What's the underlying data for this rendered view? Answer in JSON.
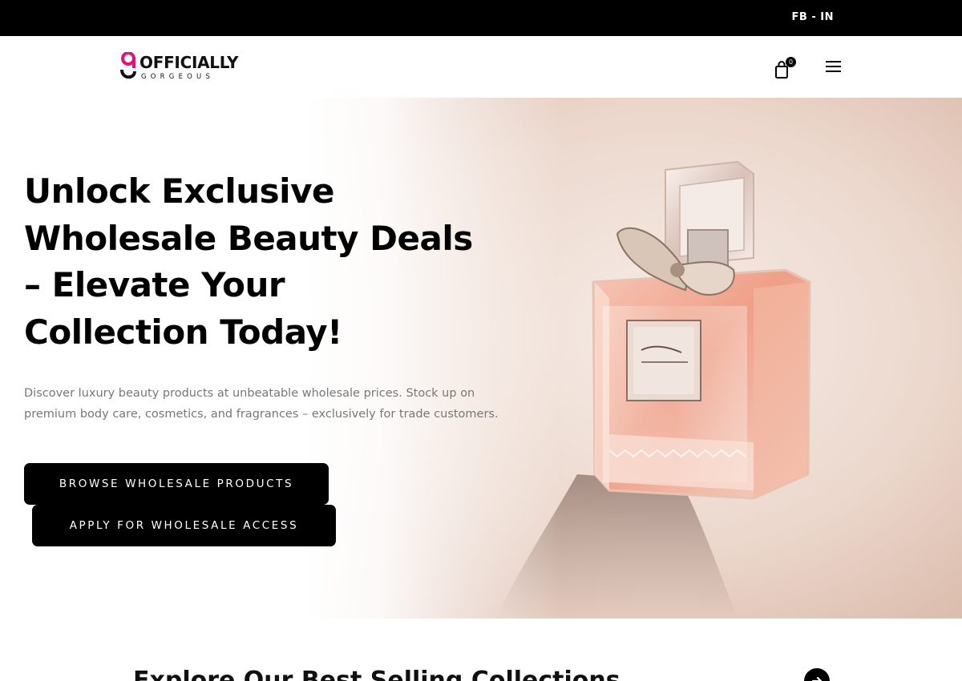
{
  "topbar": {
    "social_text": "FB - IN"
  },
  "header": {
    "logo_word": "OFFICIALLY",
    "logo_sub": "GORGEOUS",
    "cart_count": "0",
    "brand_colors": {
      "pink": "#e0137a",
      "black": "#111111"
    }
  },
  "hero": {
    "title": "Unlock Exclusive Wholesale Beauty Deals – Elevate Your Collection Today!",
    "description": "Discover luxury beauty products at unbeatable wholesale prices. Stock up on premium body care, cosmetics, and fragrances – exclusively for trade customers.",
    "browse_label": "BROWSE WHOLESALE PRODUCTS",
    "apply_label": "APPLY FOR WHOLESALE ACCESS",
    "image_subject": "perfume-bottle"
  },
  "collections": {
    "title": "Explore Our Best Selling Collections",
    "arrow_icon": "arrow-right-icon"
  }
}
